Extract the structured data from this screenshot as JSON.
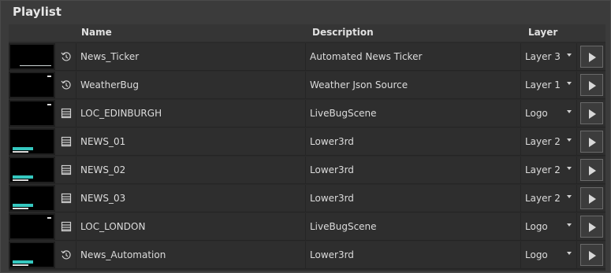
{
  "panel": {
    "title": "Playlist"
  },
  "columns": {
    "name": "Name",
    "description": "Description",
    "layer": "Layer"
  },
  "rows": [
    {
      "name": "News_Ticker",
      "description": "Automated News Ticker",
      "layer": "Layer 3",
      "icon": "history-icon",
      "thumbnail": "ticker"
    },
    {
      "name": "WeatherBug",
      "description": "Weather Json Source",
      "layer": "Layer 1",
      "icon": "history-icon",
      "thumbnail": "bug"
    },
    {
      "name": "LOC_EDINBURGH",
      "description": "LiveBugScene",
      "layer": "Logo",
      "icon": "list-icon",
      "thumbnail": "bug"
    },
    {
      "name": "NEWS_01",
      "description": "Lower3rd",
      "layer": "Layer 2",
      "icon": "list-icon",
      "thumbnail": "lower-third"
    },
    {
      "name": "NEWS_02",
      "description": "Lower3rd",
      "layer": "Layer 2",
      "icon": "list-icon",
      "thumbnail": "lower-third"
    },
    {
      "name": "NEWS_03",
      "description": "Lower3rd",
      "layer": "Layer 2",
      "icon": "list-icon",
      "thumbnail": "lower-third"
    },
    {
      "name": "LOC_LONDON",
      "description": "LiveBugScene",
      "layer": "Logo",
      "icon": "list-icon",
      "thumbnail": "bug"
    },
    {
      "name": "News_Automation",
      "description": "Lower3rd",
      "layer": "Logo",
      "icon": "history-icon",
      "thumbnail": "lower-third"
    }
  ]
}
